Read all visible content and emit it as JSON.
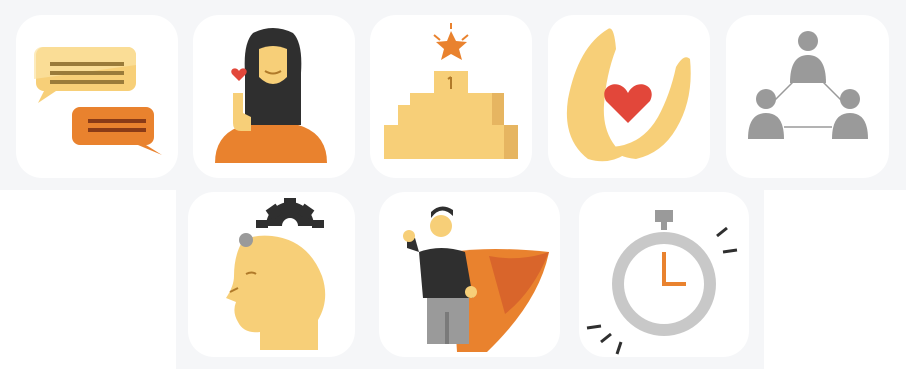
{
  "colors": {
    "background": "#f5f6f8",
    "tile": "#ffffff",
    "yellow": "#f7cf78",
    "yellow_light": "#fbe3a3",
    "orange": "#e9822e",
    "orange_dark": "#d9652b",
    "red": "#e2473a",
    "gray": "#9a9a9a",
    "dark": "#2f2f2f"
  },
  "icons": [
    {
      "id": "chat",
      "name": "chat-bubbles-icon"
    },
    {
      "id": "woman",
      "name": "woman-with-heart-icon"
    },
    {
      "id": "podium",
      "name": "podium-star-icon"
    },
    {
      "id": "hands",
      "name": "hands-heart-icon"
    },
    {
      "id": "network",
      "name": "people-network-icon"
    },
    {
      "id": "head",
      "name": "head-gear-icon"
    },
    {
      "id": "hero",
      "name": "superhero-icon"
    },
    {
      "id": "stopwatch",
      "name": "stopwatch-icon"
    }
  ]
}
